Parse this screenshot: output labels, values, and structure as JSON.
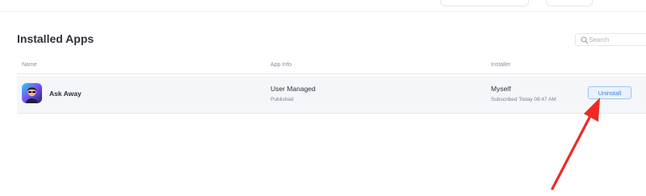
{
  "page": {
    "title": "Installed Apps"
  },
  "search": {
    "placeholder": "Search"
  },
  "table": {
    "columns": [
      "Name",
      "App Info",
      "Installer"
    ],
    "rows": [
      {
        "name": "Ask Away",
        "app_info": "User Managed",
        "app_status": "Published",
        "installer": "Myself",
        "installed_note": "Subscribed Today 08:47 AM",
        "action_label": "Uninstall",
        "avatar_icon": "app-avatar-icon"
      }
    ]
  },
  "colors": {
    "accent": "#3b7ed6",
    "button_bg": "#eaf3fd",
    "row_bg": "#f4f6f9",
    "arrow": "#ee2a24"
  }
}
